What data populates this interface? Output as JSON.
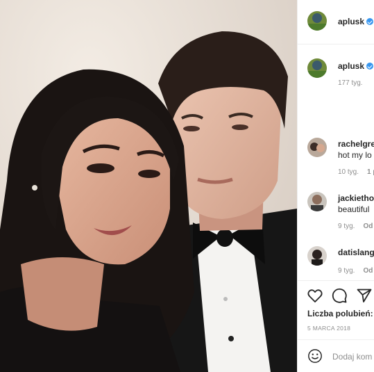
{
  "header": {
    "username": "aplusk",
    "verified": true
  },
  "caption": {
    "username": "aplusk",
    "time": "177 tyg."
  },
  "comments": [
    {
      "username": "rachelgre",
      "text": "hot my lo",
      "time": "10 tyg.",
      "extra": "1 p"
    },
    {
      "username": "jackietho",
      "text": "beautiful",
      "time": "9 tyg.",
      "extra": "Od"
    },
    {
      "username": "datislang",
      "text": "",
      "time": "9 tyg.",
      "extra": "Od"
    }
  ],
  "actions": {
    "like": "heart-icon",
    "comment": "comment-icon",
    "share": "share-icon"
  },
  "likes_label": "Liczba polubień:",
  "date": "5 MARCA 2018",
  "add_comment_placeholder": "Dodaj kom",
  "colors": {
    "verified": "#3897f0",
    "text": "#262626",
    "muted": "#8e8e8e"
  }
}
